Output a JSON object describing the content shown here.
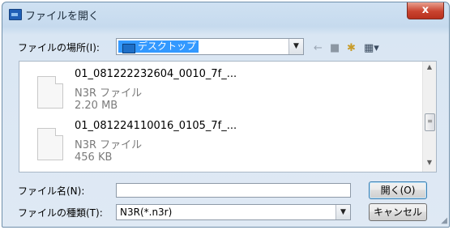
{
  "window": {
    "title": "ファイルを開く",
    "close_label": "x"
  },
  "location": {
    "label": "ファイルの場所(I):",
    "value": "デスクトップ"
  },
  "toolbar": {
    "back_icon": "back-arrow-icon",
    "up_icon": "up-folder-icon",
    "new_folder_icon": "new-folder-icon",
    "view_icon": "view-menu-icon"
  },
  "files": [
    {
      "name": "01_081222232604_0010_7f_...",
      "type": "N3R ファイル",
      "size": "2.20 MB"
    },
    {
      "name": "01_081224110016_0105_7f_...",
      "type": "N3R ファイル",
      "size": "456 KB"
    }
  ],
  "filename": {
    "label": "ファイル名(N):",
    "value": ""
  },
  "filetype": {
    "label": "ファイルの種類(T):",
    "value": "N3R(*.n3r)"
  },
  "buttons": {
    "open": "開く(O)",
    "cancel": "キャンセル"
  }
}
